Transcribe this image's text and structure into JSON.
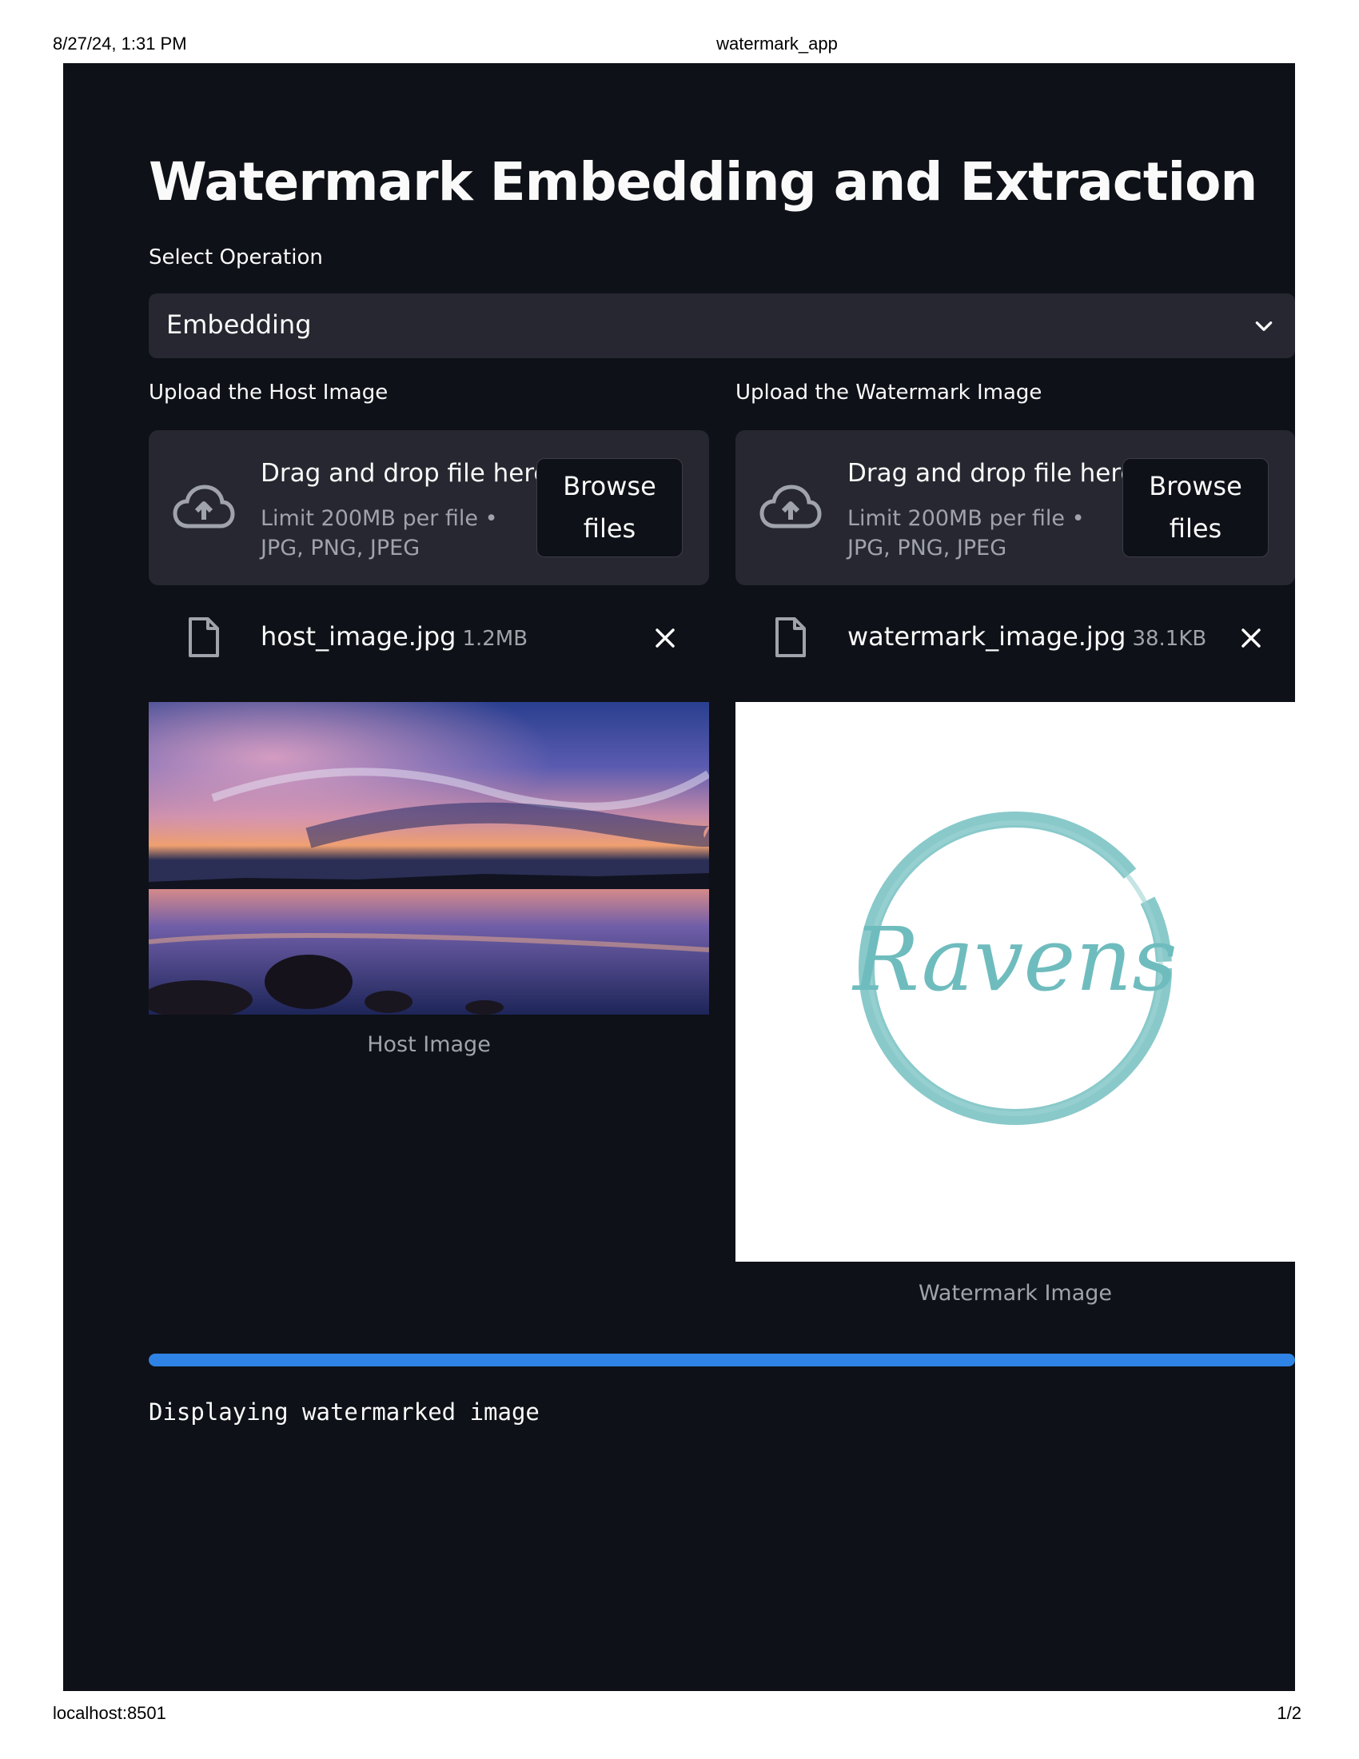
{
  "print": {
    "datetime": "8/27/24, 1:31 PM",
    "doc_title": "watermark_app",
    "url": "localhost:8501",
    "page": "1/2"
  },
  "app": {
    "title": "Watermark Embedding and Extraction",
    "operation": {
      "label": "Select Operation",
      "selected": "Embedding",
      "icon": "chevron-down-icon"
    },
    "host_uploader": {
      "label": "Upload the Host Image",
      "drop_text": "Drag and drop file here",
      "limit_text": "Limit 200MB per file • JPG, PNG, JPEG",
      "browse_label": "Browse files",
      "file_name": "host_image.jpg",
      "file_size": "1.2MB"
    },
    "watermark_uploader": {
      "label": "Upload the Watermark Image",
      "drop_text": "Drag and drop file here",
      "limit_text": "Limit 200MB per file • JPG, PNG, JPEG",
      "browse_label": "Browse files",
      "file_name": "watermark_image.jpg",
      "file_size": "38.1KB"
    },
    "host_caption": "Host Image",
    "watermark_caption": "Watermark Image",
    "watermark_logo_text": "Ravens",
    "progress": 1.0,
    "status": "Displaying watermarked image"
  },
  "colors": {
    "background": "#0e1117",
    "surface": "#262730",
    "text": "#fafafa",
    "muted": "#a0a3ab",
    "progress": "#2f83e4",
    "logo": "#7cc3c4"
  }
}
